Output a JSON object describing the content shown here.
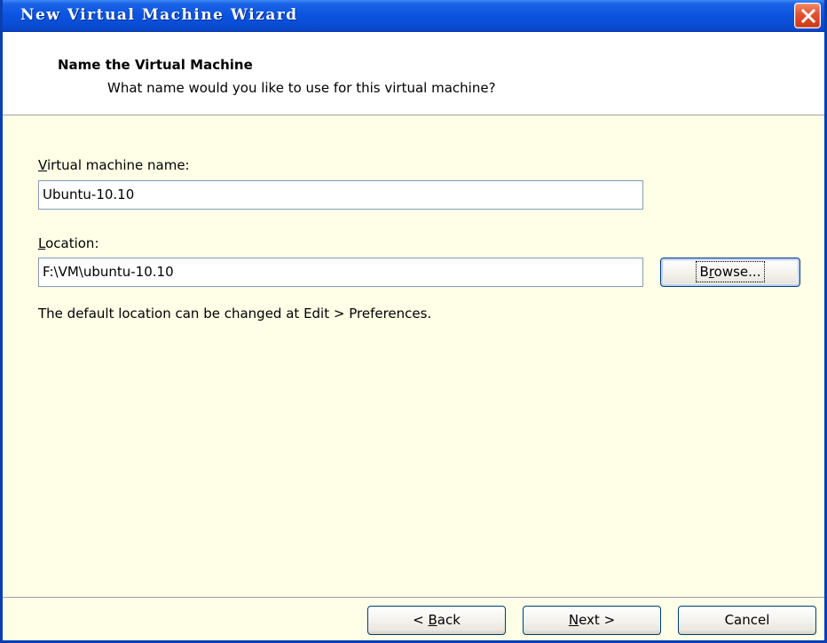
{
  "window": {
    "title": "New Virtual Machine Wizard",
    "close_icon": "close-icon"
  },
  "header": {
    "title": "Name the Virtual Machine",
    "subtitle": "What name would you like to use for this virtual machine?"
  },
  "form": {
    "vm_name_label_mnemonic": "V",
    "vm_name_label_rest": "irtual machine name:",
    "vm_name_value": "Ubuntu-10.10",
    "location_label_mnemonic": "L",
    "location_label_rest": "ocation:",
    "location_value": "F:\\VM\\ubuntu-10.10",
    "browse_pre": "B",
    "browse_mnemonic": "r",
    "browse_rest": "owse...",
    "hint": "The default location can be changed at Edit > Preferences."
  },
  "footer": {
    "back_pre": "< ",
    "back_mnemonic": "B",
    "back_rest": "ack",
    "next_mnemonic": "N",
    "next_rest": "ext >",
    "cancel_label": "Cancel"
  },
  "colors": {
    "titlebar": "#0a4fd8",
    "content_background": "#ffffe7",
    "close_button": "#e0532e"
  }
}
